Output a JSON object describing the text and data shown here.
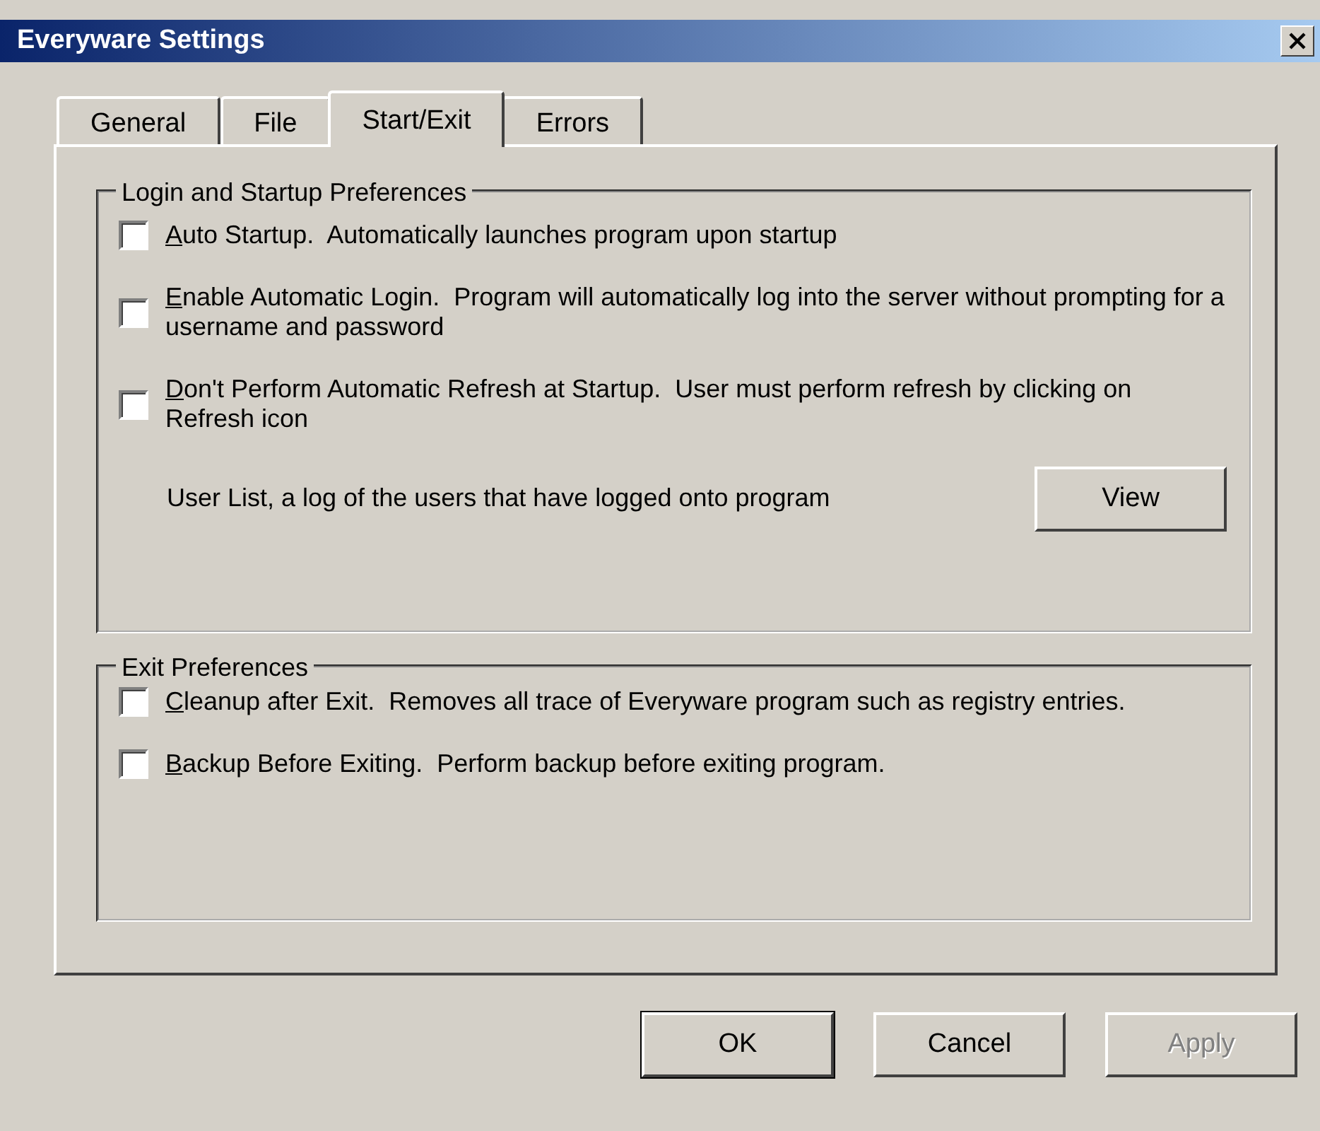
{
  "window": {
    "title": "Everyware Settings"
  },
  "tabs": [
    {
      "label": "General",
      "selected": false
    },
    {
      "label": "File",
      "selected": false
    },
    {
      "label": "Start/Exit",
      "selected": true
    },
    {
      "label": "Errors",
      "selected": false
    }
  ],
  "groups": [
    {
      "title": "Login and Startup Preferences",
      "items": [
        {
          "kind": "checkbox",
          "label": "Auto Startup.  Automatically launches program upon startup",
          "checked": false
        },
        {
          "kind": "checkbox",
          "label": "Enable Automatic Login.  Program will automatically log into the server without prompting for a username and password",
          "checked": false
        },
        {
          "kind": "checkbox",
          "label": "Don't Perform Automatic Refresh at Startup.  User must perform refresh by clicking on Refresh icon",
          "checked": false
        },
        {
          "kind": "action",
          "label": "User List, a log of the users that have logged onto program",
          "button": "View"
        }
      ]
    },
    {
      "title": "Exit Preferences",
      "items": [
        {
          "kind": "checkbox",
          "label": "Cleanup after Exit.  Removes all trace of Everyware program such as registry entries.",
          "checked": false
        },
        {
          "kind": "checkbox",
          "label": "Backup Before Exiting.  Perform backup before exiting program.",
          "checked": false
        }
      ]
    }
  ],
  "buttons": [
    {
      "label": "OK",
      "default": true,
      "disabled": false
    },
    {
      "label": "Cancel",
      "default": false,
      "disabled": false
    },
    {
      "label": "Apply",
      "default": false,
      "disabled": true
    }
  ]
}
